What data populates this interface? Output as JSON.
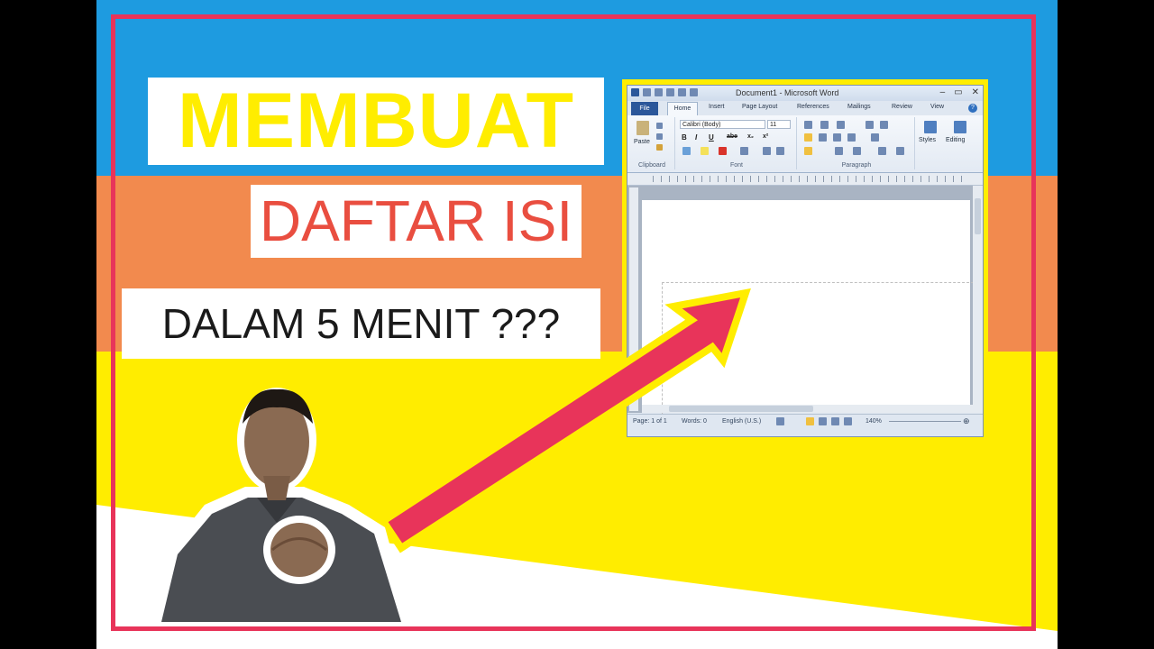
{
  "headline": {
    "line1": "MEMBUAT",
    "line2": "DAFTAR ISI",
    "line3": "DALAM 5 MENIT ???"
  },
  "colors": {
    "blue_band": "#1e9be0",
    "orange_band": "#f28a4e",
    "yellow_band": "#ffed00",
    "frame": "#e8345a",
    "arrow": "#e8345a",
    "word_blue": "#2b579a"
  },
  "word": {
    "window_title": "Document1 - Microsoft Word",
    "tabs": [
      "File",
      "Home",
      "Insert",
      "Page Layout",
      "References",
      "Mailings",
      "Review",
      "View"
    ],
    "ribbon": {
      "paste_label": "Paste",
      "clipboard_label": "Clipboard",
      "font_name": "Calibri (Body)",
      "font_size": "11",
      "font_label": "Font",
      "paragraph_label": "Paragraph",
      "styles_label": "Styles",
      "editing_label": "Editing",
      "format_buttons": [
        "B",
        "I",
        "U",
        "abe",
        "x₂",
        "x²"
      ]
    },
    "status": {
      "page": "Page: 1 of 1",
      "words": "Words: 0",
      "language": "English (U.S.)",
      "zoom": "140%"
    },
    "icons": [
      "word-logo-icon",
      "save-icon",
      "undo-icon",
      "redo-icon",
      "minimize-icon",
      "maximize-icon",
      "close-icon",
      "help-icon"
    ]
  },
  "presenter": {
    "description_icon": "presenter-photo"
  }
}
